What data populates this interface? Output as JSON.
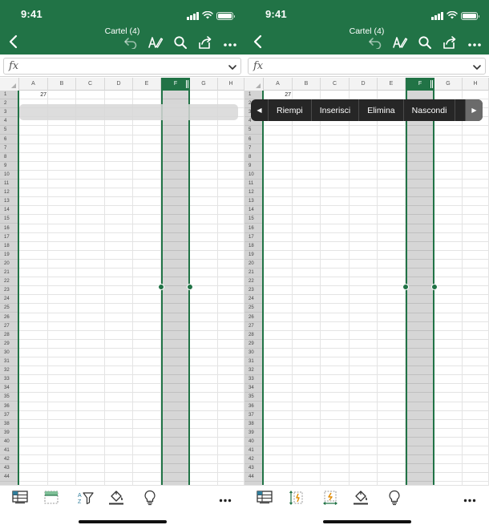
{
  "status_bar": {
    "time": "9:41"
  },
  "document": {
    "title": "Cartel (4)"
  },
  "columns": [
    "A",
    "B",
    "C",
    "D",
    "E",
    "F",
    "G",
    "H"
  ],
  "selected_column": "F",
  "rows": [
    "1",
    "2",
    "3",
    "4",
    "5",
    "6",
    "7",
    "8",
    "9",
    "10",
    "11",
    "12",
    "13",
    "14",
    "15",
    "16",
    "17",
    "18",
    "19",
    "20",
    "21",
    "22",
    "23",
    "24",
    "25",
    "26",
    "27",
    "28",
    "29",
    "30",
    "31",
    "32",
    "33",
    "34",
    "35",
    "36",
    "37",
    "38",
    "39",
    "40",
    "41",
    "42",
    "43",
    "44"
  ],
  "cell_values": {
    "A1": "27"
  },
  "formula_bar": {
    "fx_label": "fx",
    "value": ""
  },
  "context_menu": {
    "prev_arrow": "◀",
    "items": [
      "Riempi",
      "Inserisci",
      "Elimina",
      "Nascondi"
    ],
    "next_arrow": "▶"
  },
  "toolbar_icons": [
    "back-icon",
    "undo-icon",
    "draw-icon",
    "search-icon",
    "share-icon",
    "more-icon"
  ],
  "bottom_icons_left": [
    "table-icon",
    "freeze-panes-icon",
    "sort-filter-icon",
    "fill-color-icon",
    "lightbulb-icon",
    "more-icon"
  ],
  "bottom_icons_right": [
    "table-icon",
    "autofit-row-icon",
    "autofit-column-icon",
    "fill-color-icon",
    "lightbulb-icon",
    "more-icon"
  ],
  "colors": {
    "accent": "#217346",
    "menu_bg": "#262626"
  }
}
